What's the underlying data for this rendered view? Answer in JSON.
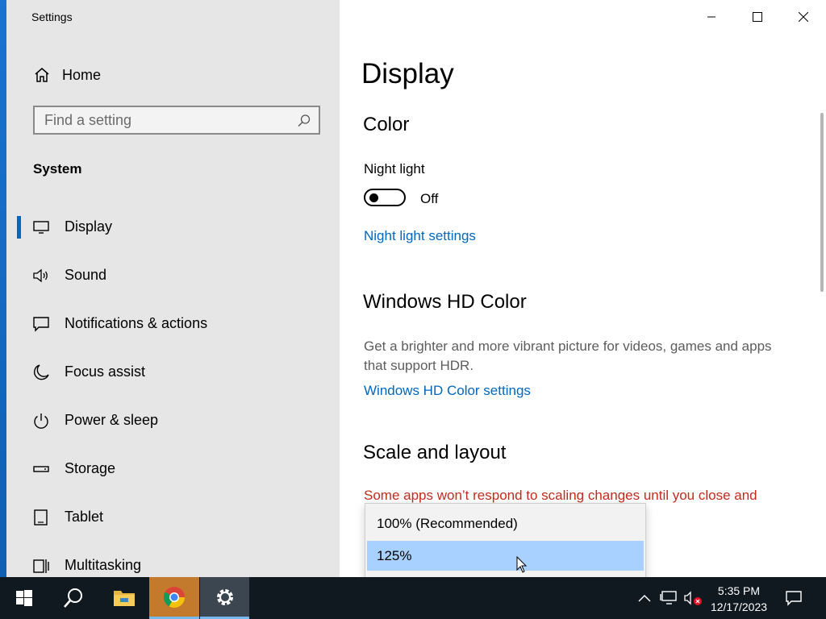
{
  "window": {
    "title": "Settings"
  },
  "sidebar": {
    "home_label": "Home",
    "search_placeholder": "Find a setting",
    "section_title": "System",
    "items": [
      {
        "label": "Display",
        "icon": "monitor-icon",
        "active": true
      },
      {
        "label": "Sound",
        "icon": "speaker-icon",
        "active": false
      },
      {
        "label": "Notifications & actions",
        "icon": "message-icon",
        "active": false
      },
      {
        "label": "Focus assist",
        "icon": "moon-icon",
        "active": false
      },
      {
        "label": "Power & sleep",
        "icon": "power-icon",
        "active": false
      },
      {
        "label": "Storage",
        "icon": "storage-icon",
        "active": false
      },
      {
        "label": "Tablet",
        "icon": "tablet-icon",
        "active": false
      },
      {
        "label": "Multitasking",
        "icon": "multitasking-icon",
        "active": false
      }
    ]
  },
  "main": {
    "title": "Display",
    "color_heading": "Color",
    "night_light_label": "Night light",
    "night_light_state": "Off",
    "night_light_link": "Night light settings",
    "hd_heading": "Windows HD Color",
    "hd_desc_line1": "Get a brighter and more vibrant picture for videos, games and apps",
    "hd_desc_line2": "that support HDR.",
    "hd_link": "Windows HD Color settings",
    "scale_heading": "Scale and layout",
    "scale_warning": "Some apps won’t respond to scaling changes until you close and"
  },
  "scale_dropdown": {
    "options": [
      "100% (Recommended)",
      "125%"
    ],
    "selected": "125%"
  },
  "taskbar": {
    "apps": [
      "start-icon",
      "search-icon",
      "file-explorer-icon",
      "chrome-icon",
      "settings-icon"
    ],
    "time": "5:35 PM",
    "date": "12/17/2023"
  },
  "colors": {
    "accent": "#0067c0",
    "warning": "#c42b1c",
    "sidebar_bg": "#e6e6e6",
    "taskbar_bg": "#101820",
    "dropdown_selected": "#a8d1ff"
  }
}
